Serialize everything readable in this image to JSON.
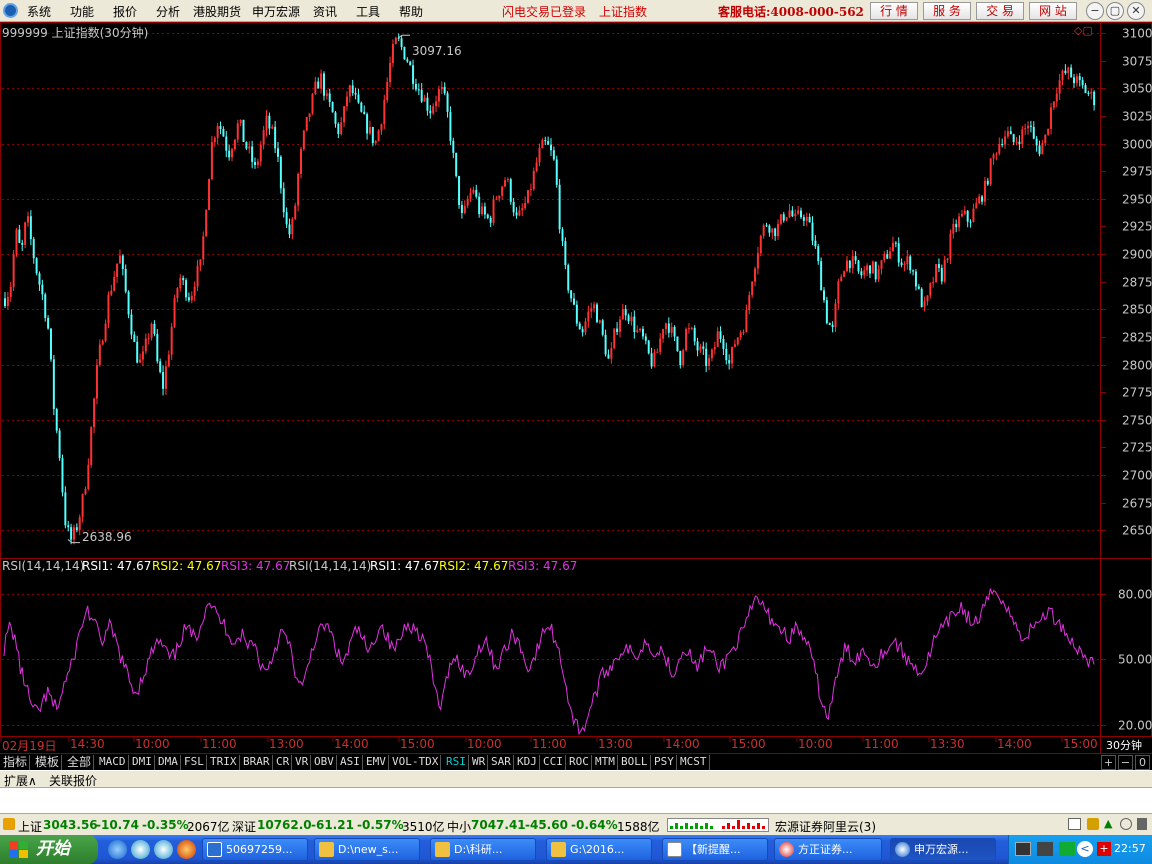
{
  "menubar": {
    "items": [
      "系统",
      "功能",
      "报价",
      "分析",
      "港股期货",
      "申万宏源",
      "资讯",
      "工具",
      "帮助"
    ],
    "status_login": "闪电交易已登录",
    "status_index": "上证指数",
    "service_phone": "客服电话:4008-000-562",
    "nav_buttons": [
      "行 情",
      "服 务",
      "交 易",
      "网 站"
    ],
    "window_buttons": [
      "−",
      "▢",
      "✕"
    ]
  },
  "chart_header": {
    "title": "999999 上证指数(30分钟)",
    "high_label": "3097.16",
    "low_label": "2638.96"
  },
  "rsi_header": {
    "name": "RSI(14,14,14)",
    "rsi1": "RSI1: 47.67",
    "rsi2": "RSI2: 47.67",
    "rsi3": "RSI3: 47.67"
  },
  "colors": {
    "up": "#ff3232",
    "down": "#54ffff",
    "rsi": "#e232e2",
    "grid": "#8c0000",
    "axis_text": "#c8c8c8",
    "rsi2_text": "#ffff00",
    "rsi3_text": "#e232e2"
  },
  "time_axis": {
    "labels": [
      "02月19日",
      "14:30",
      "10:00",
      "11:00",
      "13:00",
      "14:00",
      "15:00",
      "10:00",
      "11:00",
      "13:00",
      "14:00",
      "15:00",
      "10:00",
      "11:00",
      "13:30",
      "14:00",
      "15:00"
    ],
    "period": "30分钟"
  },
  "tabs": [
    "指标",
    "模板",
    "全部",
    "MACD",
    "DMI",
    "DMA",
    "FSL",
    "TRIX",
    "BRAR",
    "CR",
    "VR",
    "OBV",
    "ASI",
    "EMV",
    "VOL-TDX",
    "RSI",
    "WR",
    "SAR",
    "KDJ",
    "CCI",
    "ROC",
    "MTM",
    "BOLL",
    "PSY",
    "MCST"
  ],
  "active_tab": "RSI",
  "tab_buttons": [
    "+",
    "−",
    "0"
  ],
  "extbar": {
    "items": [
      "扩展∧",
      "关联报价"
    ]
  },
  "ticker": {
    "sh": {
      "name": "上证",
      "price": "3043.56",
      "change": "-10.74",
      "pct": "-0.35%",
      "amount": "2067亿"
    },
    "sz": {
      "name": "深证",
      "price": "10762.0",
      "change": "-61.21",
      "pct": "-0.57%",
      "amount": "3510亿"
    },
    "sme": {
      "name": "中小",
      "price": "7047.41",
      "change": "-45.60",
      "pct": "-0.64%",
      "amount": "1588亿"
    },
    "server": "宏源证券阿里云(3)"
  },
  "taskbar": {
    "start_label": "开始",
    "buttons": [
      "50697259...",
      "D:\\new_s...",
      "D:\\科研...",
      "G:\\2016...",
      "【新提醒...",
      "方正证券...",
      "申万宏源..."
    ],
    "clock": "22:57"
  },
  "chart_data": [
    {
      "type": "candlestick",
      "title": "999999 上证指数(30分钟)",
      "ylim": [
        2625,
        3110
      ],
      "yticks": [
        2650,
        2675,
        2700,
        2725,
        2750,
        2775,
        2800,
        2825,
        2850,
        2875,
        2900,
        2925,
        2950,
        2975,
        3000,
        3025,
        3050,
        3075,
        3100
      ],
      "annotations": [
        {
          "label": "3097.16",
          "value": 3097.16
        },
        {
          "label": "2638.96",
          "value": 2638.96
        }
      ],
      "close_path": [
        2860,
        2870,
        2920,
        2900,
        2935,
        2905,
        2880,
        2860,
        2830,
        2760,
        2720,
        2660,
        2640,
        2650,
        2670,
        2700,
        2750,
        2800,
        2830,
        2860,
        2880,
        2900,
        2870,
        2840,
        2810,
        2800,
        2820,
        2840,
        2800,
        2780,
        2810,
        2850,
        2880,
        2870,
        2860,
        2880,
        2890,
        2950,
        3000,
        3020,
        3010,
        2990,
        3005,
        3020,
        3000,
        2990,
        2975,
        3000,
        3020,
        3010,
        2990,
        2950,
        2915,
        2930,
        2980,
        3010,
        3030,
        3050,
        3060,
        3040,
        3030,
        3010,
        3020,
        3050,
        3045,
        3030,
        3020,
        3010,
        3000,
        3020,
        3050,
        3080,
        3095,
        3085,
        3075,
        3060,
        3050,
        3040,
        3030,
        3040,
        3050,
        3035,
        3000,
        2960,
        2930,
        2950,
        2960,
        2940,
        2935,
        2930,
        2950,
        2960,
        2970,
        2950,
        2930,
        2940,
        2950,
        2970,
        2990,
        3000,
        2995,
        2980,
        2920,
        2880,
        2860,
        2840,
        2830,
        2845,
        2855,
        2840,
        2820,
        2800,
        2830,
        2845,
        2850,
        2840,
        2830,
        2825,
        2810,
        2800,
        2815,
        2840,
        2835,
        2820,
        2805,
        2830,
        2830,
        2815,
        2810,
        2800,
        2810,
        2830,
        2820,
        2800,
        2820,
        2830,
        2840,
        2875,
        2900,
        2920,
        2930,
        2920,
        2925,
        2935,
        2940,
        2930,
        2935,
        2935,
        2920,
        2900,
        2870,
        2840,
        2830,
        2870,
        2890,
        2895,
        2890,
        2880,
        2885,
        2890,
        2880,
        2890,
        2900,
        2910,
        2900,
        2890,
        2895,
        2880,
        2860,
        2850,
        2870,
        2885,
        2880,
        2900,
        2920,
        2930,
        2935,
        2930,
        2940,
        2950,
        2960,
        2980,
        2995,
        3005,
        3010,
        3000,
        3005,
        3010,
        3020,
        3000,
        2995,
        3005,
        3030,
        3050,
        3060,
        3065,
        3060,
        3055,
        3050,
        3045,
        3040
      ]
    },
    {
      "type": "line",
      "title": "RSI(14,14,14)",
      "ylim": [
        15,
        88
      ],
      "yticks": [
        20,
        50,
        80
      ],
      "series": [
        {
          "name": "RSI1",
          "current": 47.67
        }
      ],
      "values": [
        55,
        65,
        60,
        45,
        38,
        28,
        25,
        30,
        35,
        28,
        30,
        40,
        45,
        55,
        65,
        73,
        68,
        62,
        58,
        65,
        60,
        52,
        45,
        38,
        35,
        42,
        48,
        55,
        58,
        55,
        50,
        52,
        60,
        65,
        60,
        62,
        70,
        78,
        72,
        68,
        65,
        60,
        58,
        62,
        55,
        60,
        50,
        45,
        48,
        55,
        62,
        60,
        52,
        40,
        36,
        48,
        58,
        62,
        66,
        62,
        55,
        48,
        52,
        60,
        64,
        58,
        52,
        60,
        66,
        62,
        55,
        56,
        62,
        68,
        64,
        62,
        58,
        48,
        35,
        28,
        40,
        52,
        50,
        45,
        42,
        50,
        56,
        60,
        52,
        46,
        52,
        56,
        62,
        58,
        50,
        46,
        52,
        58,
        66,
        63,
        56,
        46,
        32,
        22,
        18,
        20,
        28,
        35,
        42,
        45,
        48,
        52,
        55,
        54,
        50,
        55,
        58,
        56,
        52,
        55,
        48,
        44,
        50,
        56,
        52,
        46,
        50,
        55,
        52,
        46,
        48,
        52,
        56,
        60,
        65,
        72,
        78,
        75,
        70,
        68,
        65,
        62,
        60,
        64,
        62,
        58,
        50,
        40,
        28,
        24,
        36,
        46,
        55,
        52,
        50,
        54,
        52,
        48,
        50,
        54,
        56,
        58,
        55,
        50,
        48,
        46,
        44,
        50,
        58,
        62,
        65,
        68,
        72,
        74,
        70,
        66,
        68,
        72,
        78,
        82,
        80,
        74,
        70,
        64,
        60,
        62,
        64,
        68,
        70,
        72,
        68,
        66,
        62,
        58,
        55,
        52,
        50,
        47.67
      ]
    }
  ]
}
